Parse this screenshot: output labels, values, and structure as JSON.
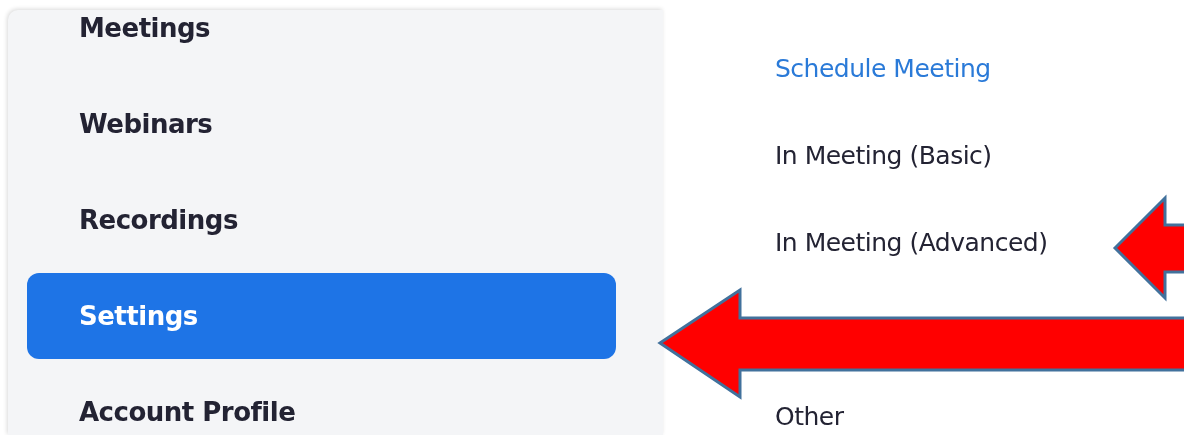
{
  "sidebar": {
    "items": [
      {
        "label": "Meetings",
        "selected": false
      },
      {
        "label": "Webinars",
        "selected": false
      },
      {
        "label": "Recordings",
        "selected": false
      },
      {
        "label": "Settings",
        "selected": true
      },
      {
        "label": "Account Profile",
        "selected": false
      }
    ]
  },
  "settings_nav": {
    "items": [
      {
        "label": "Schedule Meeting",
        "selected": true
      },
      {
        "label": "In Meeting (Basic)",
        "selected": false
      },
      {
        "label": "In Meeting (Advanced)",
        "selected": false
      },
      {
        "label": "Other",
        "selected": false
      }
    ]
  },
  "annotations": [
    {
      "kind": "arrow"
    },
    {
      "kind": "arrow"
    }
  ]
}
